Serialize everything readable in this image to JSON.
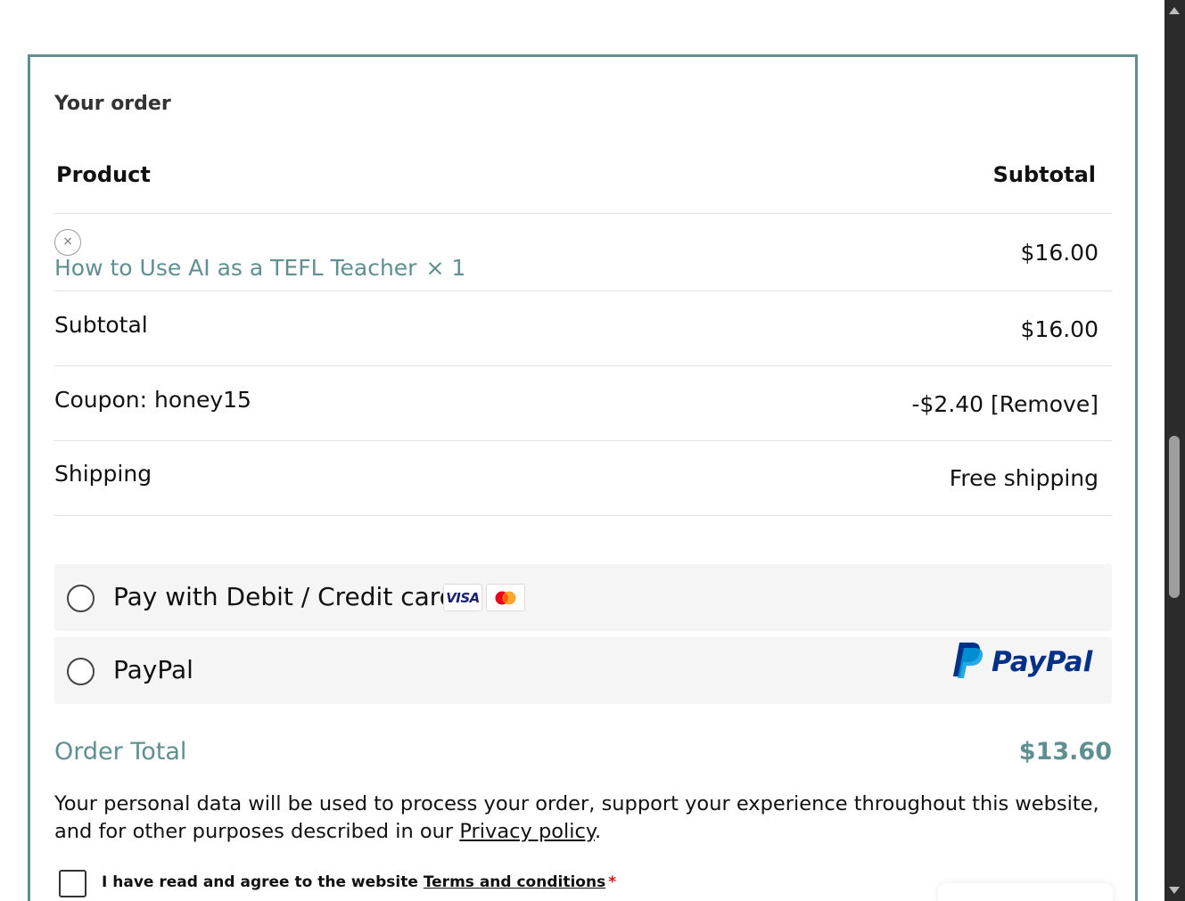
{
  "order": {
    "title": "Your order",
    "col_product": "Product",
    "col_subtotal": "Subtotal",
    "item": {
      "remove_glyph": "×",
      "name": "How to Use AI as a TEFL Teacher",
      "qty": "× 1",
      "price": "$16.00"
    },
    "subtotal_label": "Subtotal",
    "subtotal_value": "$16.00",
    "coupon_label": "Coupon: honey15",
    "coupon_amount": "-$2.40",
    "coupon_remove": "[Remove]",
    "shipping_label": "Shipping",
    "shipping_value": "Free shipping"
  },
  "payment": {
    "card_label": "Pay with Debit / Credit card",
    "visa_text": "VISA",
    "paypal_label": "PayPal",
    "paypal_logo_text": "PayPal"
  },
  "total": {
    "label": "Order Total",
    "value": "$13.60"
  },
  "privacy": {
    "text_before": "Your personal data will be used to process your order, support your experience throughout this website, and for other purposes described in our ",
    "link": "Privacy policy",
    "text_after": "."
  },
  "terms": {
    "text_before": "I have read and agree to the website ",
    "link": "Terms and conditions",
    "required": "*"
  },
  "colors": {
    "accent": "#5f8f90",
    "paypal_dark": "#003087",
    "paypal_light": "#009cde",
    "mastercard_red": "#eb001b",
    "mastercard_orange": "#f79e1b"
  }
}
